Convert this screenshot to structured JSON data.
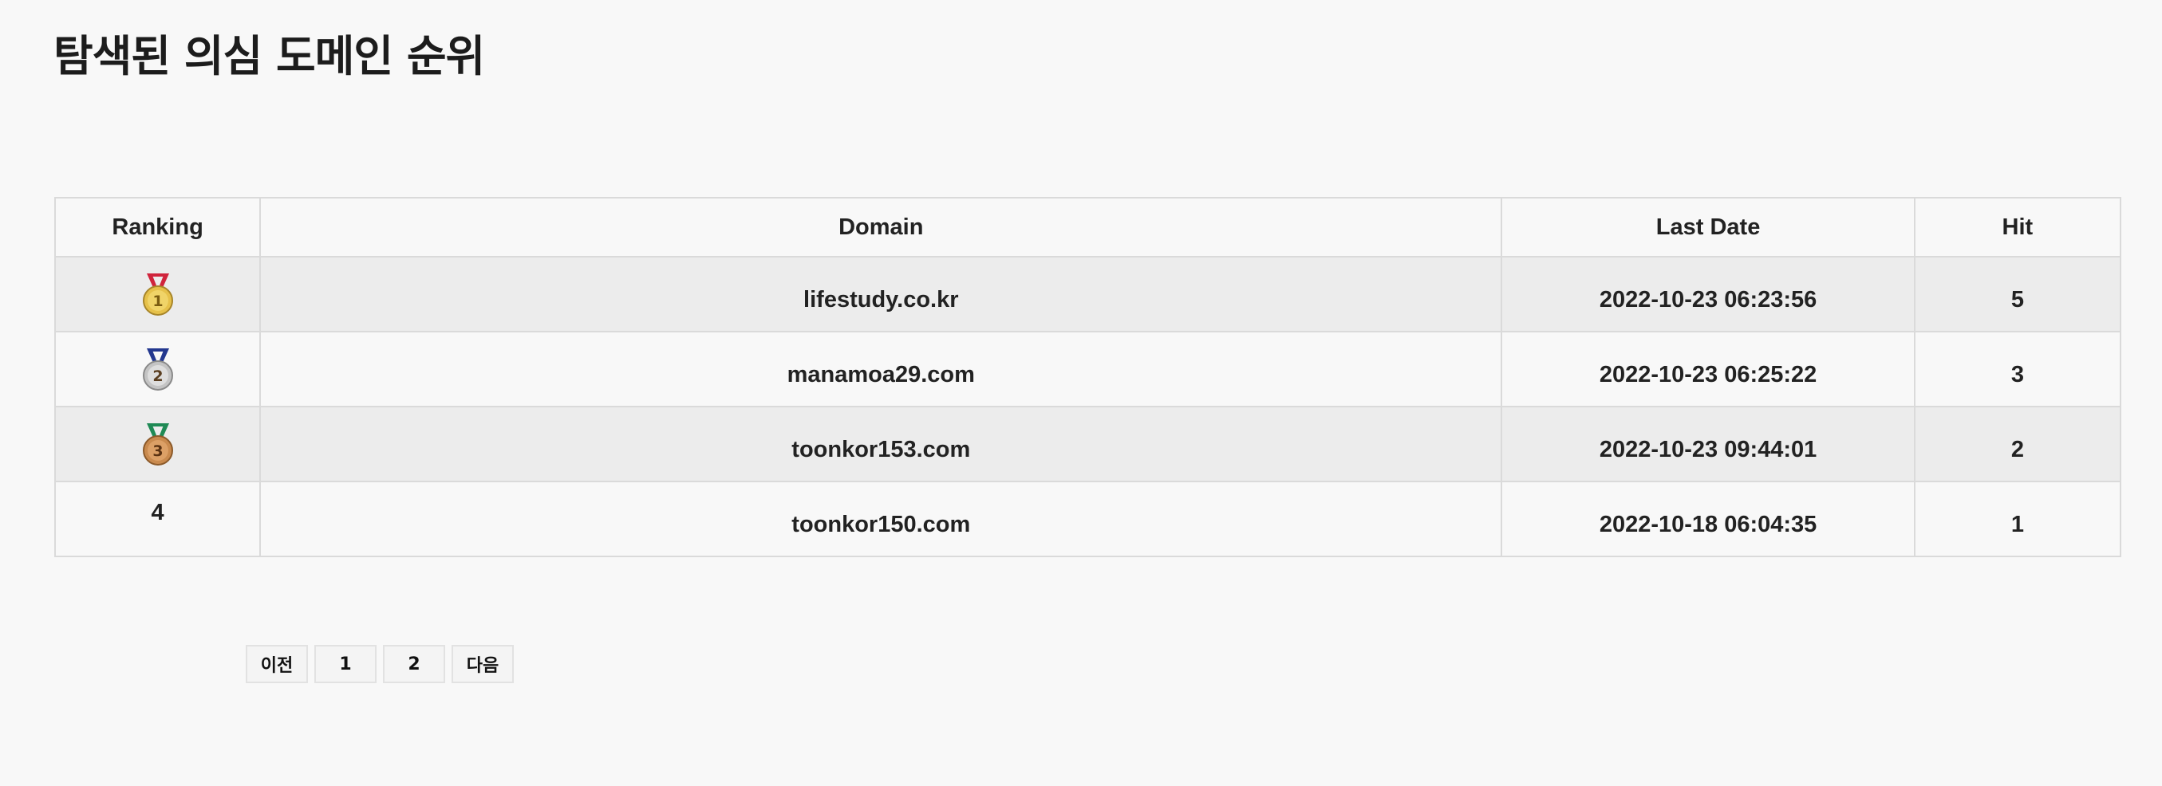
{
  "page": {
    "title": "탐색된 의심 도메인 순위"
  },
  "table": {
    "headers": {
      "ranking": "Ranking",
      "domain": "Domain",
      "last_date": "Last Date",
      "hit": "Hit"
    },
    "rows": [
      {
        "rank": "1",
        "rank_icon": "gold-medal-icon",
        "domain": "lifestudy.co.kr",
        "last_date": "2022-10-23 06:23:56",
        "hit": "5"
      },
      {
        "rank": "2",
        "rank_icon": "silver-medal-icon",
        "domain": "manamoa29.com",
        "last_date": "2022-10-23 06:25:22",
        "hit": "3"
      },
      {
        "rank": "3",
        "rank_icon": "bronze-medal-icon",
        "domain": "toonkor153.com",
        "last_date": "2022-10-23 09:44:01",
        "hit": "2"
      },
      {
        "rank": "4",
        "rank_icon": "",
        "domain": "toonkor150.com",
        "last_date": "2022-10-18 06:04:35",
        "hit": "1"
      }
    ]
  },
  "pagination": {
    "prev": "이전",
    "pages": [
      "1",
      "2"
    ],
    "next": "다음"
  },
  "colors": {
    "gold": "#e6c14a",
    "silver": "#c4c4c4",
    "bronze": "#c98a4e",
    "ribbon_gold": "#d0243c",
    "ribbon_silver": "#23388f",
    "ribbon_bronze": "#1f8a55"
  }
}
